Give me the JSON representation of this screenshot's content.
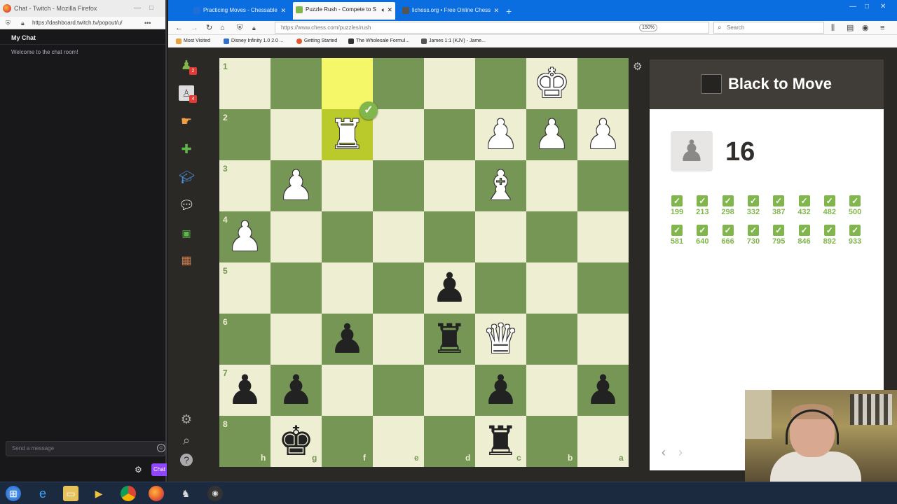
{
  "twitch": {
    "window_title": "Chat - Twitch - Mozilla Firefox",
    "url": "https://dashboard.twitch.tv/popout/u/",
    "header": "My Chat",
    "welcome": "Welcome to the chat room!",
    "input_placeholder": "Send a message",
    "chat_button": "Chat"
  },
  "browser": {
    "tabs": [
      {
        "label": "Practicing Moves - Chessable",
        "icon_color": "#1e6fd9"
      },
      {
        "label": "Puzzle Rush - Compete to S",
        "icon_color": "#81b64c"
      },
      {
        "label": "lichess.org • Free Online Chess",
        "icon_color": "#555555"
      }
    ],
    "url": "https://www.chess.com/puzzles/rush",
    "zoom": "150%",
    "search_placeholder": "Search",
    "bookmarks": [
      {
        "label": "Most Visited",
        "icon_color": "#e8a33d"
      },
      {
        "label": "Disney Infinity 1.0 2.0 ...",
        "icon_color": "#2f6fd0"
      },
      {
        "label": "Getting Started",
        "icon_color": "#e4572e"
      },
      {
        "label": "The Wholesale Formul...",
        "icon_color": "#333333"
      },
      {
        "label": "James 1:1 (KJV) - Jame...",
        "icon_color": "#555555"
      }
    ]
  },
  "puzzle": {
    "to_move": "Black to Move",
    "score": "16",
    "results": [
      "199",
      "213",
      "298",
      "332",
      "387",
      "432",
      "482",
      "500",
      "581",
      "640",
      "666",
      "730",
      "795",
      "846",
      "892",
      "933"
    ],
    "accent": "#81b64c"
  },
  "nav_badges": {
    "puzzles": "2",
    "learn": "4"
  },
  "board": {
    "ranks": [
      "1",
      "2",
      "3",
      "4",
      "5",
      "6",
      "7",
      "8"
    ],
    "files": [
      "h",
      "g",
      "f",
      "e",
      "d",
      "c",
      "b",
      "a"
    ],
    "highlight": [
      "f1",
      "f2"
    ],
    "pieces": [
      {
        "sq": "b1",
        "glyph": "♚",
        "color": "w"
      },
      {
        "sq": "f2",
        "glyph": "♜",
        "color": "w"
      },
      {
        "sq": "c2",
        "glyph": "♟",
        "color": "w"
      },
      {
        "sq": "b2",
        "glyph": "♟",
        "color": "w"
      },
      {
        "sq": "a2",
        "glyph": "♟",
        "color": "w"
      },
      {
        "sq": "g3",
        "glyph": "♟",
        "color": "w"
      },
      {
        "sq": "c3",
        "glyph": "♝",
        "color": "w"
      },
      {
        "sq": "h4",
        "glyph": "♟",
        "color": "w"
      },
      {
        "sq": "d5",
        "glyph": "♟",
        "color": "b"
      },
      {
        "sq": "f6",
        "glyph": "♟",
        "color": "b"
      },
      {
        "sq": "d6",
        "glyph": "♜",
        "color": "b"
      },
      {
        "sq": "c6",
        "glyph": "♛",
        "color": "w"
      },
      {
        "sq": "h7",
        "glyph": "♟",
        "color": "b"
      },
      {
        "sq": "g7",
        "glyph": "♟",
        "color": "b"
      },
      {
        "sq": "c7",
        "glyph": "♟",
        "color": "b"
      },
      {
        "sq": "a7",
        "glyph": "♟",
        "color": "b"
      },
      {
        "sq": "g8",
        "glyph": "♚",
        "color": "b"
      },
      {
        "sq": "c8",
        "glyph": "♜",
        "color": "b"
      }
    ]
  }
}
